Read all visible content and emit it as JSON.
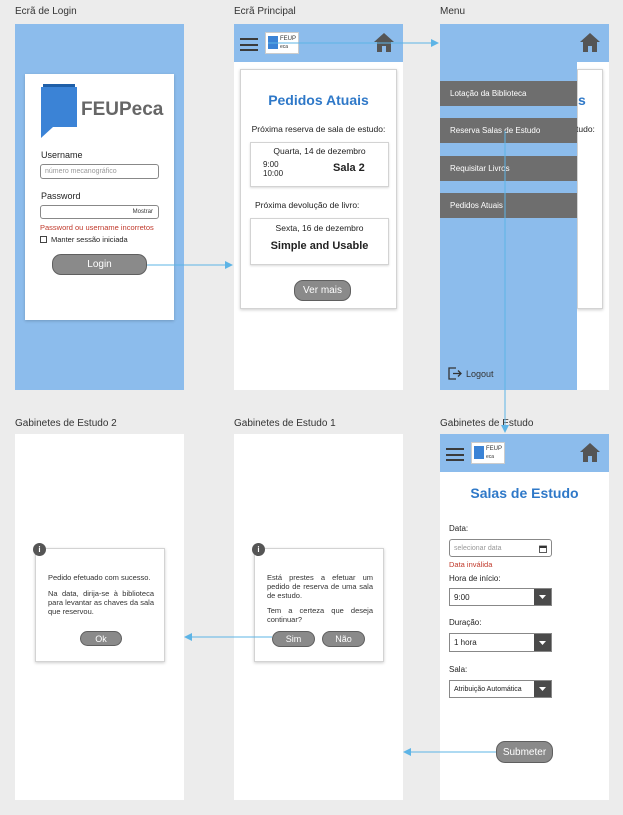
{
  "titles": {
    "login": "Ecrã de Login",
    "principal": "Ecrã Principal",
    "menu": "Menu",
    "gab2": "Gabinetes de Estudo 2",
    "gab1": "Gabinetes de Estudo 1",
    "gab": "Gabinetes de Estudo"
  },
  "brand": {
    "name": "FEUPeca",
    "mini_top": "FEUP",
    "mini_bottom": "eca"
  },
  "login": {
    "username_label": "Username",
    "username_placeholder": "número mecanográfico",
    "password_label": "Password",
    "show_label": "Mostrar",
    "error": "Password ou username incorretos",
    "keep_session": "Manter sessão iniciada",
    "login_button": "Login"
  },
  "principal": {
    "heading": "Pedidos Atuais",
    "next_room_label": "Próxima reserva de sala de estudo:",
    "room_date": "Quarta, 14 de dezembro",
    "room_time_start": "9:00",
    "room_time_end": "10:00",
    "room_name": "Sala 2",
    "next_book_label": "Próxima devolução de livro:",
    "book_date": "Sexta, 16 de dezembro",
    "book_title": "Simple and Usable",
    "more_button": "Ver mais"
  },
  "menu": {
    "items": [
      "Lotação da Biblioteca",
      "Reserva Salas de Estudo",
      "Requisitar Livros",
      "Pedidos Atuais"
    ],
    "logout": "Logout",
    "bg_heading_fragment": "s",
    "bg_label_fragment": "tudo:"
  },
  "gab": {
    "heading": "Salas de Estudo",
    "date_label": "Data:",
    "date_placeholder": "selecionar data",
    "date_error": "Data inválida",
    "start_label": "Hora de início:",
    "start_value": "9:00",
    "duration_label": "Duração:",
    "duration_value": "1 hora",
    "room_label": "Sala:",
    "room_value": "Atribuição Automática",
    "submit": "Submeter"
  },
  "gab1": {
    "line1": "Está prestes a efetuar um pedido de reserva de uma sala de estudo.",
    "line2": "Tem a certeza que deseja continuar?",
    "yes": "Sim",
    "no": "Não"
  },
  "gab2": {
    "line1": "Pedido efetuado com sucesso.",
    "line2": "Na data, dirija-se à biblioteca para levantar as chaves da sala que reservou.",
    "ok": "Ok"
  },
  "colors": {
    "accent": "#2e78c8",
    "panel": "#8cbcec",
    "error": "#c0392b",
    "arrow": "#5db4e6"
  },
  "icons": [
    "menu-icon",
    "home-icon",
    "logo-icon",
    "calendar-icon",
    "logout-icon",
    "info-icon",
    "chevron-down-icon",
    "back-arrow-icon"
  ]
}
